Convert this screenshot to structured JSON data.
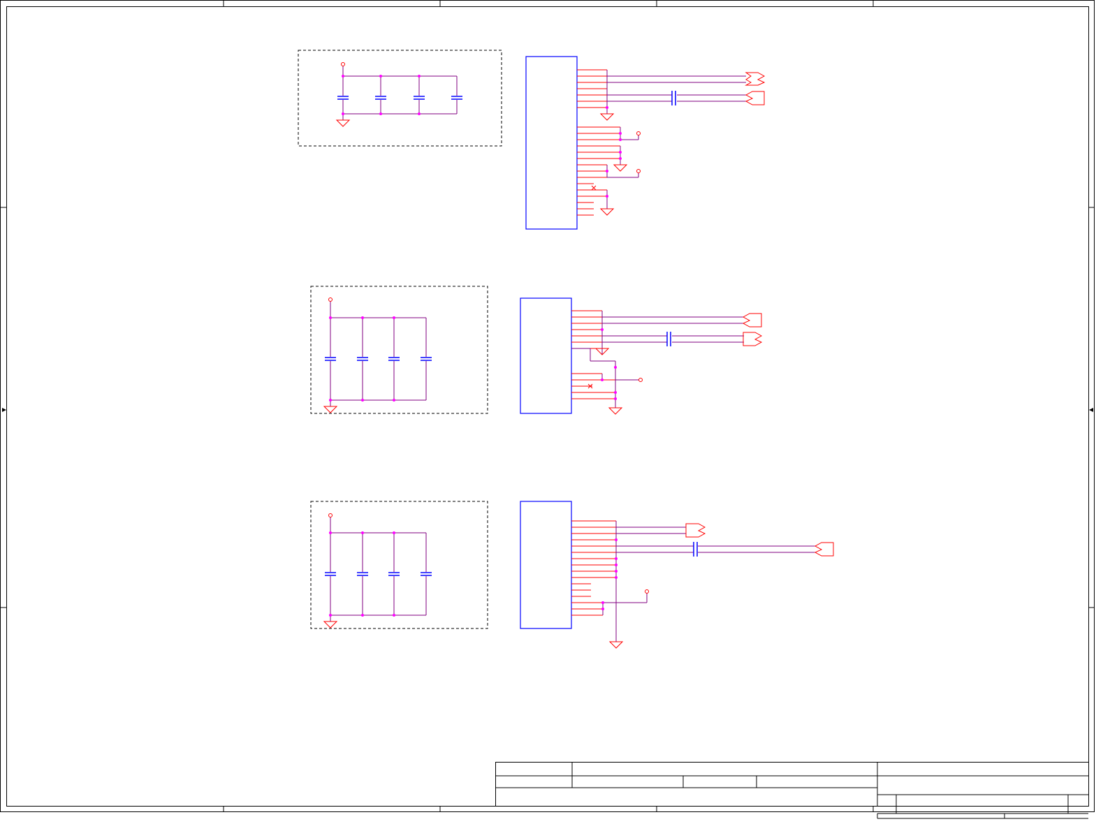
{
  "sheet": {
    "background": "#ffffff",
    "frame_color": "#000000"
  },
  "colors": {
    "pin": "#ff0000",
    "wire": "#800080",
    "component_body": "#0000ff",
    "junction": "#ff00ff",
    "power_symbol": "#ff0000",
    "dashed_box": "#000000",
    "title_block": "#000000"
  },
  "symbols": {
    "ground": "ground-icon",
    "power": "power-pin-icon",
    "capacitor": "capacitor-icon",
    "off_page_connector": "off-page-connector-icon",
    "no_connect": "no-connect-icon",
    "arrow": "arrow-icon"
  },
  "circuit_groups": [
    {
      "id": "group-1",
      "decoupling_capacitors": 4,
      "connector_pins": 26
    },
    {
      "id": "group-2",
      "decoupling_capacitors": 4,
      "connector_pins": 17
    },
    {
      "id": "group-3",
      "decoupling_capacitors": 4,
      "connector_pins": 16
    }
  ],
  "title_block": {
    "title": "",
    "size": "",
    "document_number": "",
    "revision": "",
    "date": "",
    "sheet": ""
  }
}
